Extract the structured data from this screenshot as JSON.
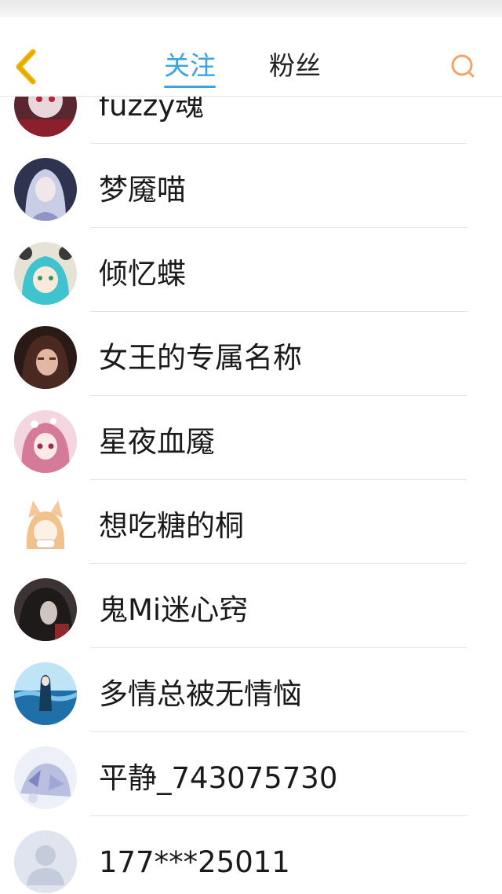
{
  "header": {
    "tabs": [
      {
        "label": "关注",
        "active": true
      },
      {
        "label": "粉丝",
        "active": false
      }
    ],
    "accent_color": "#3aa3e3",
    "search_icon_color": "#f2a36b",
    "back_icon_color": "#f0b400"
  },
  "follow_list": [
    {
      "name": "fuzzy魂",
      "avatar": "anime-avatar-red"
    },
    {
      "name": "梦魇喵",
      "avatar": "anime-avatar-silver-hair"
    },
    {
      "name": "倾忆蝶",
      "avatar": "anime-avatar-teal-hair"
    },
    {
      "name": "女王的专属名称",
      "avatar": "anime-avatar-dark-hair"
    },
    {
      "name": "星夜血魇",
      "avatar": "anime-avatar-pink-hair"
    },
    {
      "name": "想吃糖的桐",
      "avatar": "anime-avatar-fox-ears"
    },
    {
      "name": "鬼Mi迷心窍",
      "avatar": "anime-avatar-dark-portrait"
    },
    {
      "name": "多情总被无情恼",
      "avatar": "anime-avatar-ocean"
    },
    {
      "name": "平静_743075730",
      "avatar": "anime-avatar-pale-blue"
    },
    {
      "name": "177***25011",
      "avatar": "default-user-avatar"
    }
  ]
}
